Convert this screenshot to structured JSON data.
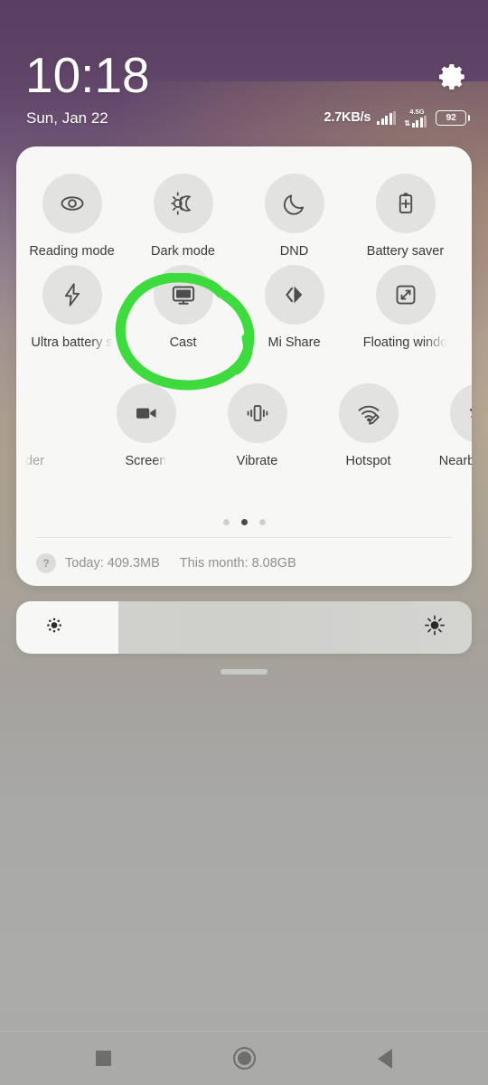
{
  "statusbar": {
    "clock": "10:18",
    "date": "Sun, Jan 22",
    "net_speed": "2.7KB/s",
    "network_generation": "4.5G",
    "battery_percent": "92",
    "settings_icon": "gear-icon",
    "signal_icon": "signal-bars-icon",
    "battery_icon": "battery-icon"
  },
  "quick_settings": {
    "rows": [
      {
        "tiles": [
          {
            "label": "Reading mode",
            "icon": "eye-icon",
            "active": false,
            "truncated": "none"
          },
          {
            "label": "Dark mode",
            "icon": "sun-moon-icon",
            "active": false,
            "truncated": "none"
          },
          {
            "label": "DND",
            "icon": "moon-icon",
            "active": false,
            "truncated": "none"
          },
          {
            "label": "Battery saver",
            "icon": "battery-plus-icon",
            "active": false,
            "truncated": "none"
          }
        ]
      },
      {
        "tiles": [
          {
            "label": "Ultra battery s",
            "icon": "lightning-bolt-icon",
            "active": false,
            "truncated": "right"
          },
          {
            "label": "Cast",
            "icon": "monitor-cast-icon",
            "active": false,
            "truncated": "none"
          },
          {
            "label": "Mi Share",
            "icon": "mi-share-icon",
            "active": false,
            "truncated": "none"
          },
          {
            "label": "Floating windo",
            "icon": "floating-window-icon",
            "active": false,
            "truncated": "right"
          }
        ]
      },
      {
        "tiles": [
          {
            "label": "der",
            "icon": "",
            "active": false,
            "truncated": "left"
          },
          {
            "label": "Screen",
            "icon": "video-camera-icon",
            "active": false,
            "truncated": "right"
          },
          {
            "label": "Vibrate",
            "icon": "vibrate-icon",
            "active": false,
            "truncated": "none"
          },
          {
            "label": "Hotspot",
            "icon": "hotspot-icon",
            "active": false,
            "truncated": "none"
          },
          {
            "label": "Nearby Share",
            "icon": "nearby-share-icon",
            "active": false,
            "truncated": "none"
          }
        ]
      }
    ],
    "pager": {
      "total": 3,
      "current": 2
    },
    "data_usage": {
      "help_label": "?",
      "today": "Today: 409.3MB",
      "this_month": "This month: 8.08GB"
    }
  },
  "brightness": {
    "low_icon": "brightness-low-icon",
    "high_icon": "brightness-high-icon",
    "fill_percent": 22
  },
  "navbar": {
    "recents": "recents-button",
    "home": "home-button",
    "back": "back-button"
  },
  "annotation": {
    "shape": "hand-drawn-circle",
    "color": "#3ddb3d",
    "target": "Cast"
  }
}
